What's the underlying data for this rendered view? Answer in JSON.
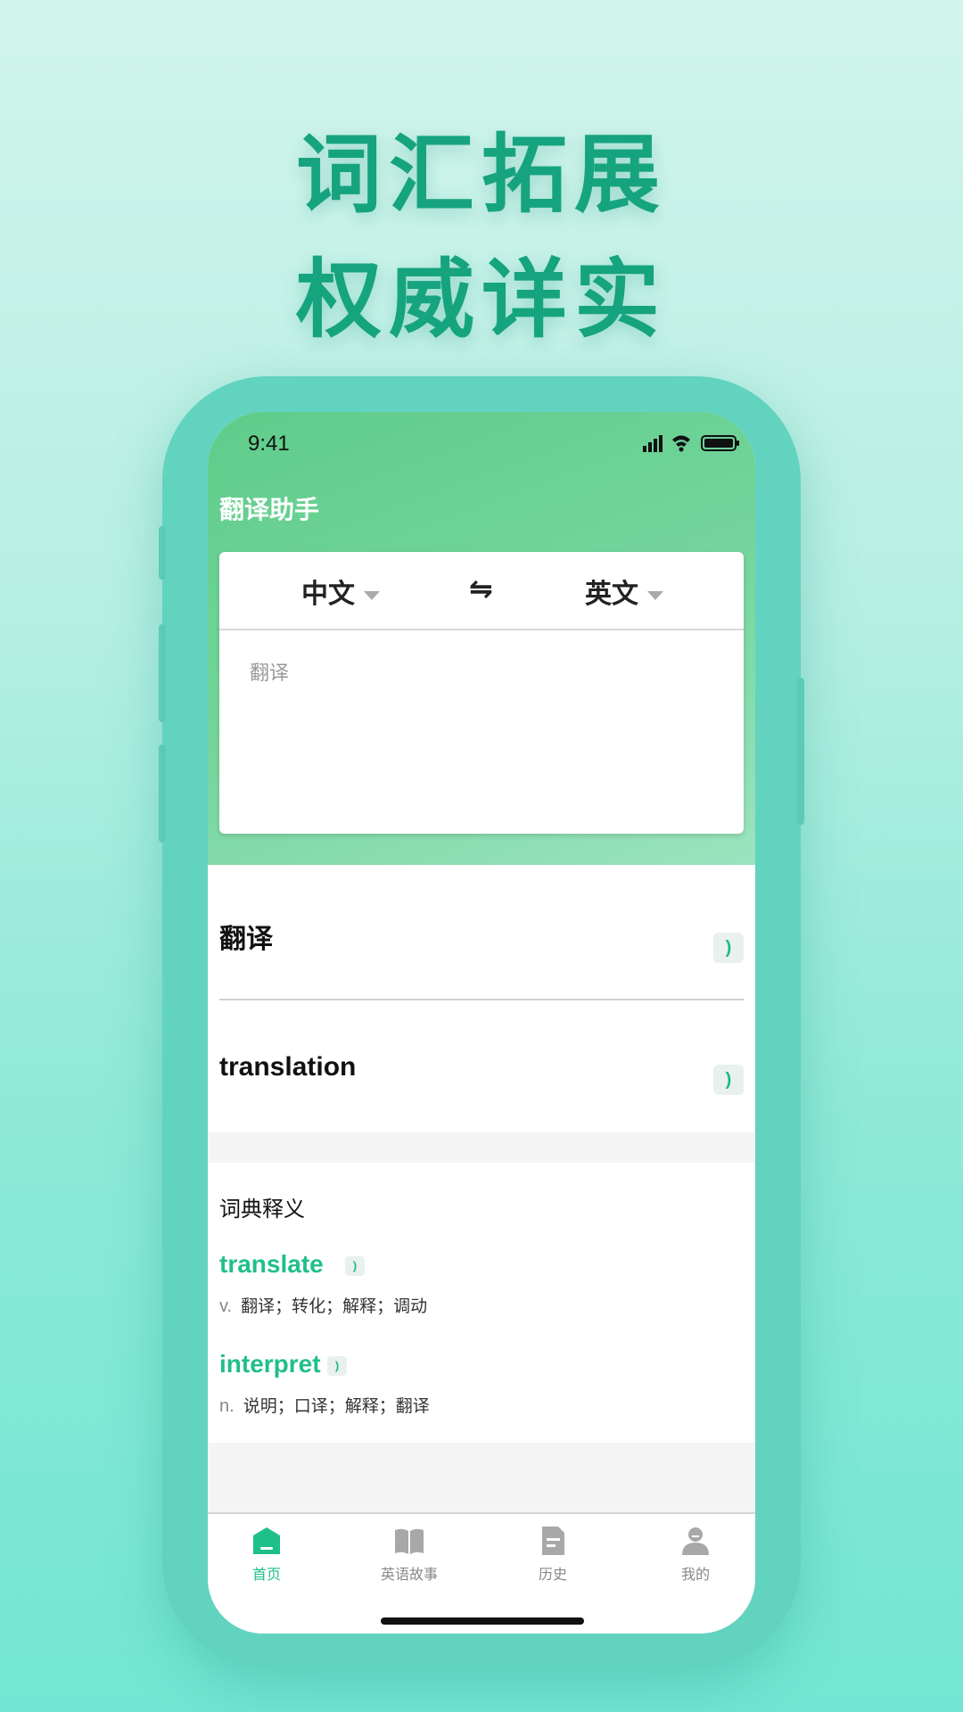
{
  "promo": {
    "line1": "词汇拓展",
    "line2": "权威详实"
  },
  "status_bar": {
    "time": "9:41",
    "icons": [
      "signal-icon",
      "wifi-icon",
      "battery-icon"
    ]
  },
  "app": {
    "title": "翻译助手"
  },
  "translator": {
    "source_lang": "中文",
    "swap_symbol": "⇋",
    "target_lang": "英文",
    "input_placeholder": "翻译"
  },
  "result": {
    "source_text": "翻译",
    "target_text": "translation"
  },
  "dictionary": {
    "title": "词典释义",
    "entries": [
      {
        "word": "translate",
        "pos": "v.",
        "meaning": "翻译；转化；解释；调动"
      },
      {
        "word": "interpret",
        "pos": "n.",
        "meaning": "说明；口译；解释；翻译"
      }
    ]
  },
  "tabbar": {
    "tabs": [
      {
        "label": "首页",
        "icon": "home-icon",
        "active": true
      },
      {
        "label": "英语故事",
        "icon": "book-icon",
        "active": false
      },
      {
        "label": "历史",
        "icon": "document-icon",
        "active": false
      },
      {
        "label": "我的",
        "icon": "user-icon",
        "active": false
      }
    ]
  },
  "colors": {
    "accent": "#1fbf8a",
    "promo_text": "#15a47e",
    "header_gradient_start": "#5fcc8a",
    "phone_frame": "#62d3bf"
  }
}
